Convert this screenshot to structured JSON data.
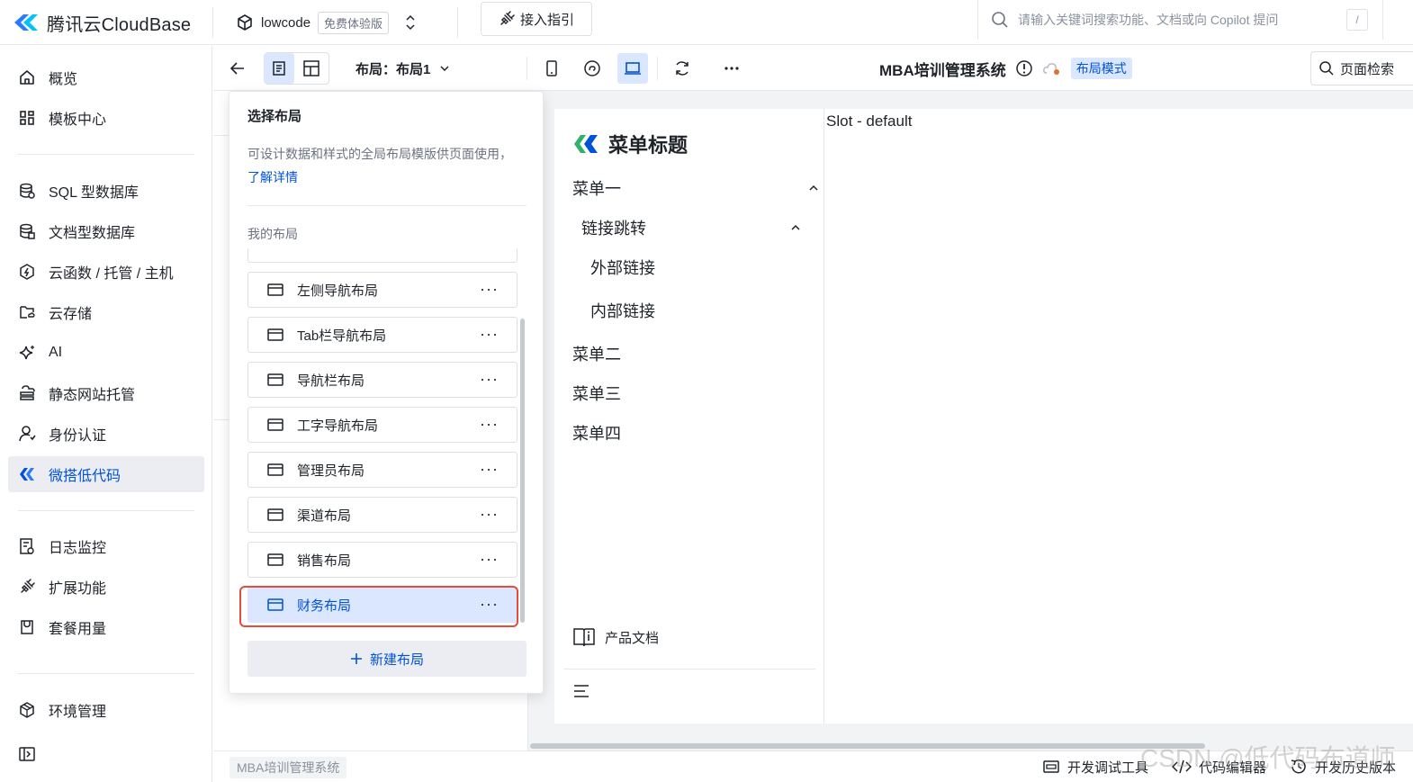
{
  "topbar": {
    "brand": "腾讯云CloudBase",
    "env_name": "lowcode",
    "env_badge": "免费体验版",
    "guide_label": "接入指引",
    "search_placeholder": "请输入关键词搜索功能、文档或向 Copilot 提问",
    "search_shortcut": "/"
  },
  "sidebar": {
    "items": [
      {
        "label": "概览",
        "icon": "home-icon"
      },
      {
        "label": "模板中心",
        "icon": "grid-icon"
      },
      {
        "label": "SQL 型数据库",
        "icon": "database-icon"
      },
      {
        "label": "文档型数据库",
        "icon": "document-database-icon"
      },
      {
        "label": "云函数 / 托管 / 主机",
        "icon": "function-icon"
      },
      {
        "label": "云存储",
        "icon": "storage-icon"
      },
      {
        "label": "AI",
        "icon": "sparkle-icon"
      },
      {
        "label": "静态网站托管",
        "icon": "hosting-icon"
      },
      {
        "label": "身份认证",
        "icon": "user-icon"
      },
      {
        "label": "微搭低代码",
        "icon": "lowcode-icon",
        "active": true
      },
      {
        "label": "日志监控",
        "icon": "log-icon"
      },
      {
        "label": "扩展功能",
        "icon": "extension-icon"
      },
      {
        "label": "套餐用量",
        "icon": "package-icon"
      },
      {
        "label": "环境管理",
        "icon": "environment-icon"
      }
    ]
  },
  "toolbar": {
    "layout_select_label": "布局：布局1",
    "app_title": "MBA培训管理系统",
    "mode_badge": "布局模式",
    "page_search_label": "页面检索"
  },
  "layout_panel": {
    "title": "选择布局",
    "description": "可设计数据和样式的全局布局模版供页面使用，",
    "learn_more": "了解详情",
    "section_label": "我的布局",
    "items": [
      {
        "label": "左侧导航布局"
      },
      {
        "label": "Tab栏导航布局"
      },
      {
        "label": "导航栏布局"
      },
      {
        "label": "工字导航布局"
      },
      {
        "label": "管理员布局"
      },
      {
        "label": "渠道布局"
      },
      {
        "label": "销售布局"
      },
      {
        "label": "财务布局",
        "selected": true
      }
    ],
    "new_button": "新建布局"
  },
  "canvas": {
    "menu_title": "菜单标题",
    "menu": [
      {
        "label": "菜单一",
        "level": 0,
        "expanded": true
      },
      {
        "label": "链接跳转",
        "level": 1,
        "expanded": true
      },
      {
        "label": "外部链接",
        "level": 2
      },
      {
        "label": "内部链接",
        "level": 2
      },
      {
        "label": "菜单二",
        "level": 0
      },
      {
        "label": "菜单三",
        "level": 0
      },
      {
        "label": "菜单四",
        "level": 0
      }
    ],
    "doc_link": "产品文档",
    "slot_text": "Slot - default"
  },
  "bottombar": {
    "page_label": "MBA培训管理系统",
    "tools": [
      {
        "label": "开发调试工具",
        "icon": "debug-icon"
      },
      {
        "label": "代码编辑器",
        "icon": "code-icon"
      },
      {
        "label": "开发历史版本",
        "icon": "history-icon"
      }
    ],
    "watermark": "CSDN @低代码布道师"
  },
  "colors": {
    "accent": "#0052d9",
    "accent_bg": "#dbe6ff",
    "highlight_border": "#e34d39",
    "canvas_bg": "#f2f3f5"
  }
}
